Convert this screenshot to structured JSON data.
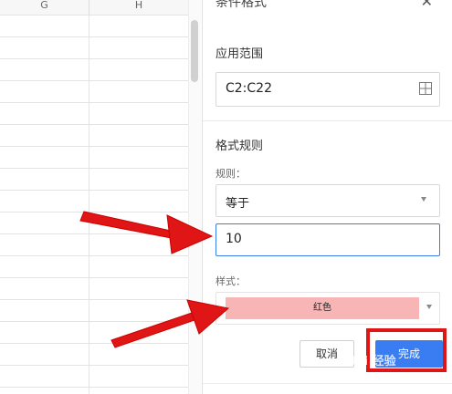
{
  "sheet": {
    "columns": [
      "G",
      "H"
    ]
  },
  "panel": {
    "title": "条件格式",
    "range_section_label": "应用范围",
    "range_value": "C2:C22",
    "rules_section_label": "格式规则",
    "rule_label": "规则：",
    "rule_selected": "等于",
    "value_input": "10",
    "style_label": "样式：",
    "style_selected": "红色",
    "cancel_label": "取消",
    "done_label": "完成"
  },
  "colors": {
    "accent": "#3a7cf2",
    "annotation_red": "#e01515",
    "style_swatch": "#f8b5b5"
  },
  "watermark": "Bai 经验"
}
